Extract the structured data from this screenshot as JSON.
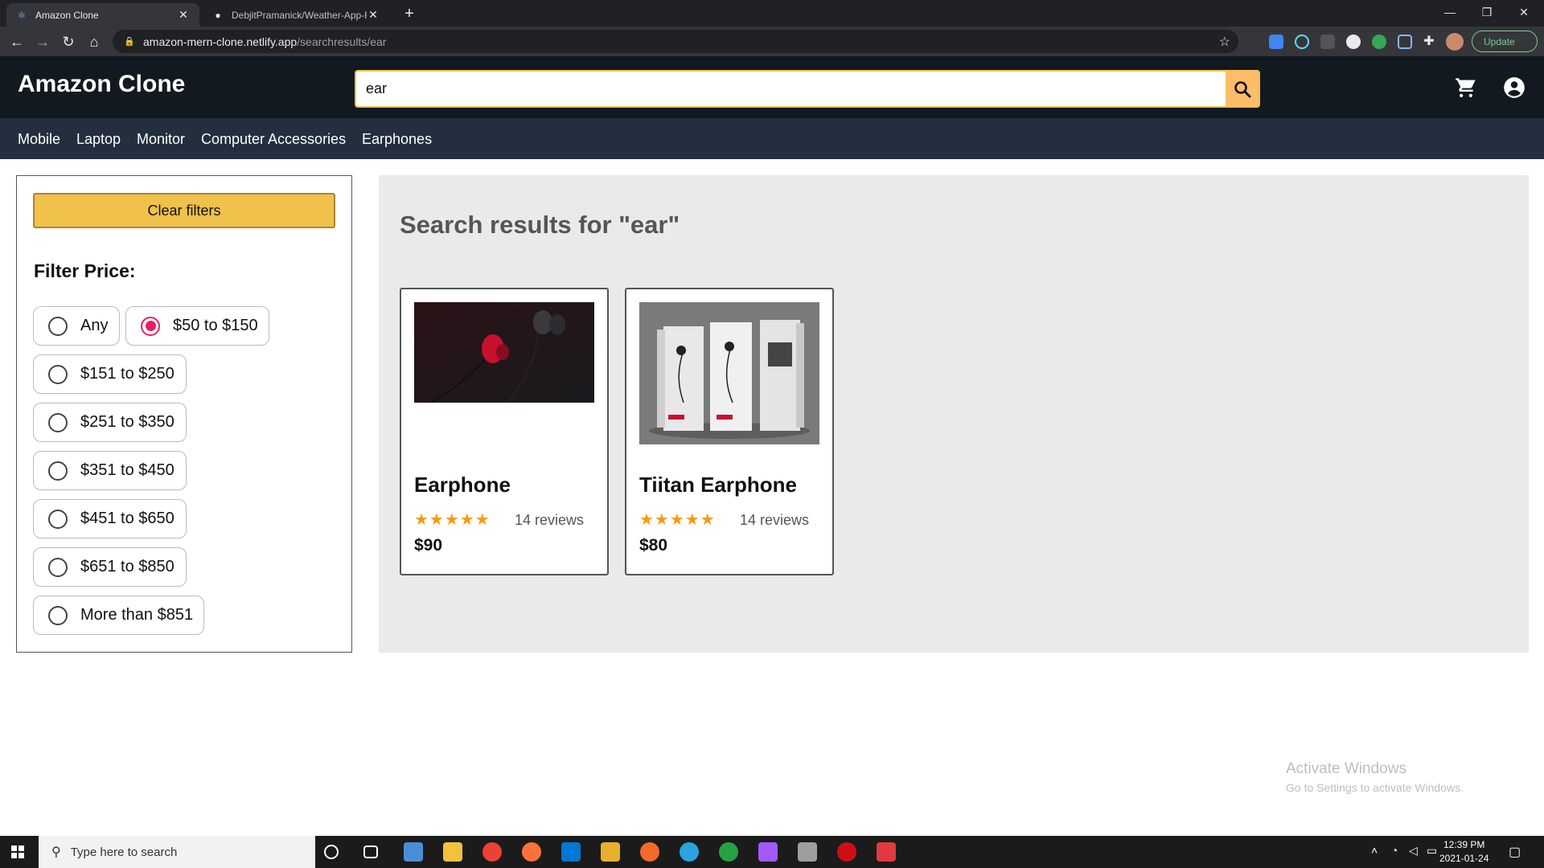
{
  "browser": {
    "tabs": [
      {
        "title": "Amazon Clone",
        "active": true
      },
      {
        "title": "DebjitPramanick/Weather-App-R",
        "active": false
      }
    ],
    "url_host": "amazon-mern-clone.netlify.app",
    "url_path": "/searchresults/ear",
    "update_label": "Update"
  },
  "header": {
    "brand": "Amazon Clone",
    "search_value": "ear"
  },
  "categories": [
    "Mobile",
    "Laptop",
    "Monitor",
    "Computer Accessories",
    "Earphones"
  ],
  "filters": {
    "clear_label": "Clear filters",
    "title": "Filter Price:",
    "options": [
      "Any",
      "$50 to $150",
      "$151 to $250",
      "$251 to $350",
      "$351 to $450",
      "$451 to $650",
      "$651 to $850",
      "More than $851"
    ],
    "selected": "$50 to $150"
  },
  "results": {
    "title": "Search results for \"ear\"",
    "products": [
      {
        "name": "Earphone",
        "rating": 5,
        "stars": "★★★★★",
        "reviews": "14 reviews",
        "price": "$90"
      },
      {
        "name": "Tiitan Earphone",
        "rating": 5,
        "stars": "★★★★★",
        "reviews": "14 reviews",
        "price": "$80"
      }
    ]
  },
  "watermark": {
    "line1": "Activate Windows",
    "line2": "Go to Settings to activate Windows."
  },
  "taskbar": {
    "search_placeholder": "Type here to search",
    "time": "12:39 PM",
    "date": "2021-01-24"
  },
  "colors": {
    "header_bg": "#131921",
    "nav_bg": "#232f3e",
    "accent": "#f0c14b",
    "radio_selected": "#e91e63",
    "star": "#f39c12"
  }
}
